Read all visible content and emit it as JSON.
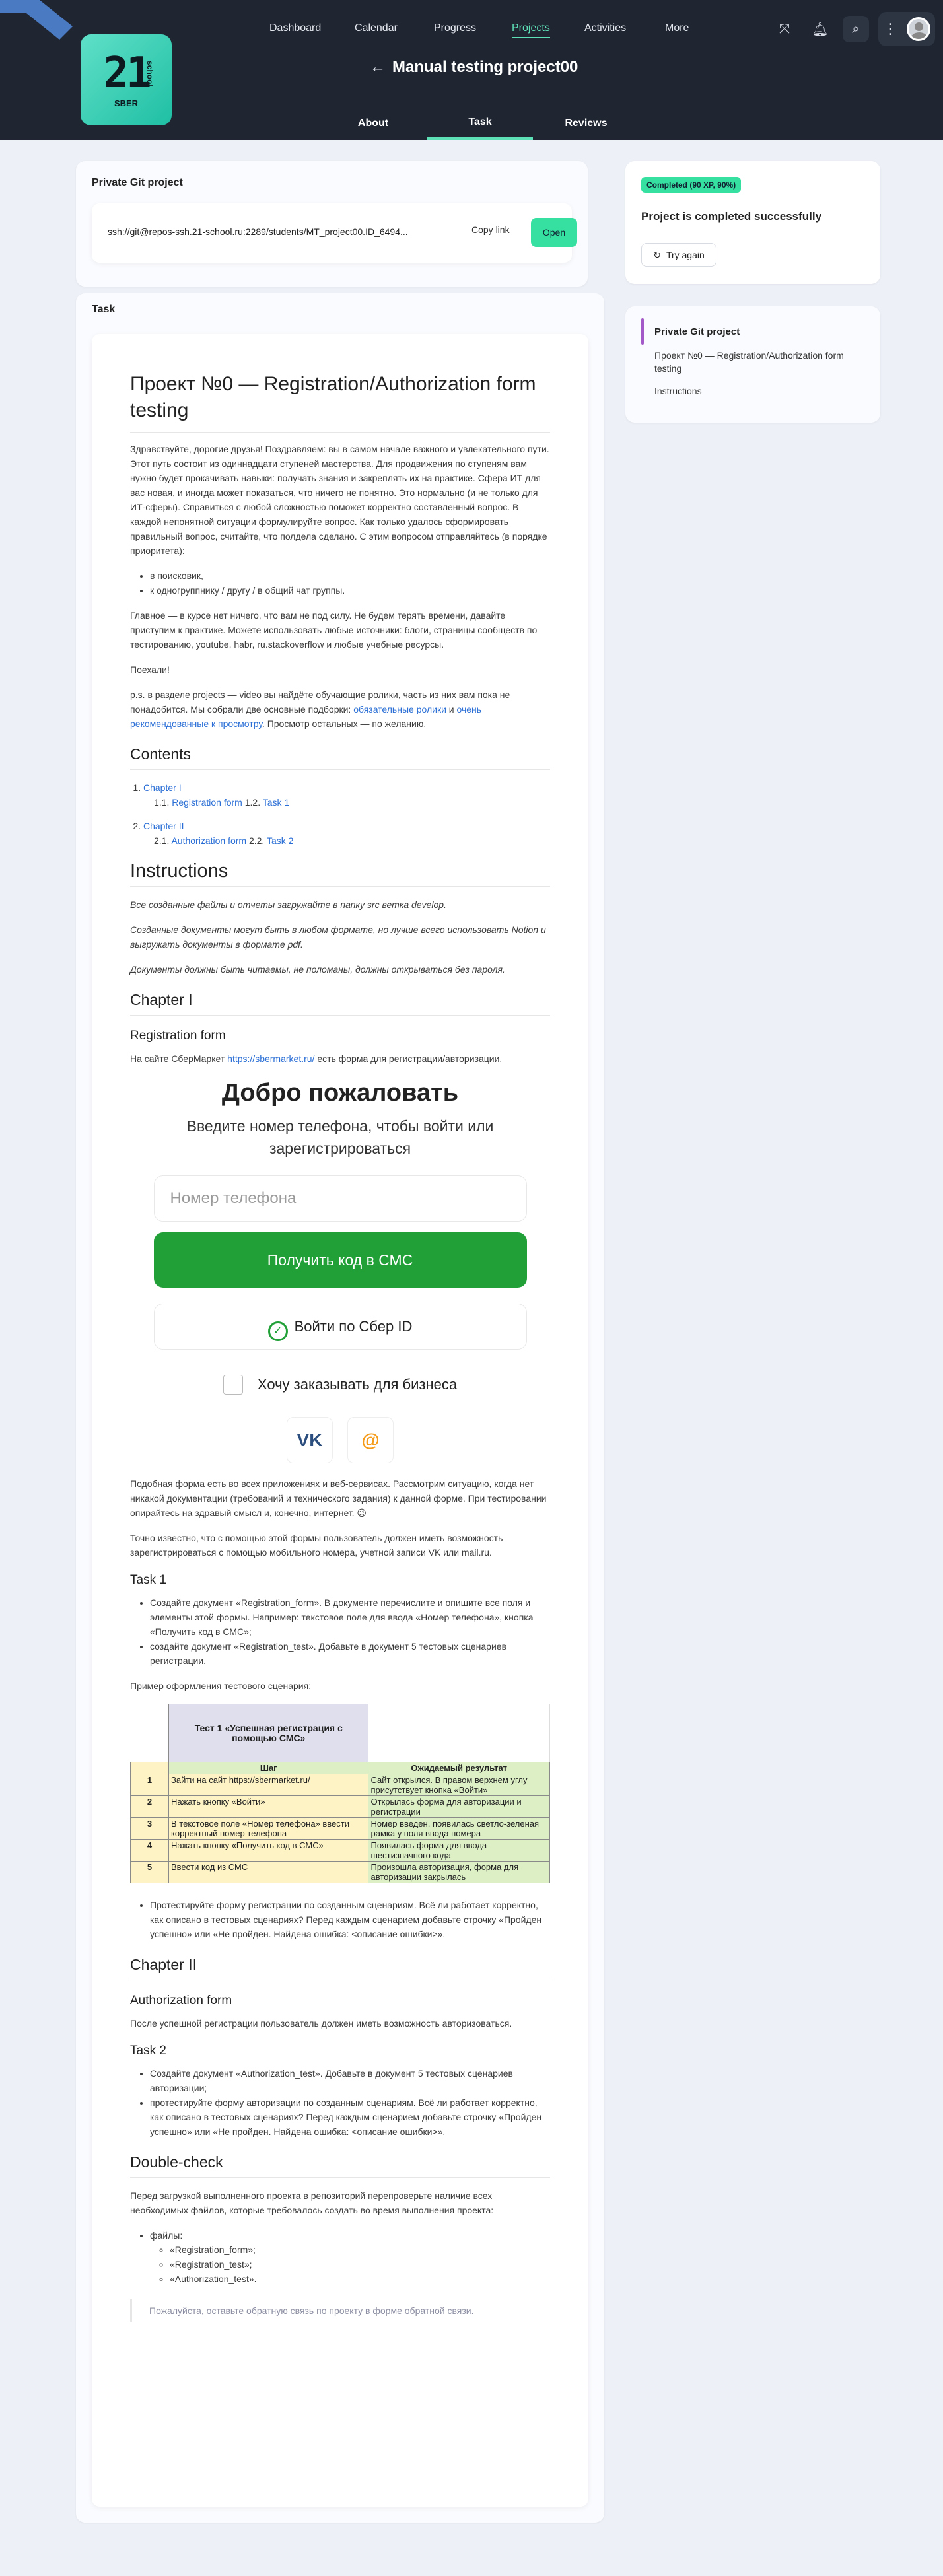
{
  "header": {
    "nav": [
      "Dashboard",
      "Calendar",
      "Progress",
      "Projects",
      "Activities",
      "More"
    ],
    "logo": {
      "big": "21",
      "side": "school",
      "sub": "SBER"
    },
    "title": "Manual testing project00",
    "tabs": [
      "About",
      "Task",
      "Reviews"
    ]
  },
  "git": {
    "label": "Private Git project",
    "path": "ssh://git@repos-ssh.21-school.ru:2289/students/MT_project00.ID_6494...",
    "copy": "Copy link",
    "open": "Open"
  },
  "status": {
    "badge": "Completed (90 XP, 90%)",
    "title": "Project is completed successfully",
    "again": "Try again"
  },
  "toc": {
    "items": [
      "Private Git project",
      "Проект №0 — Registration/Authorization form testing",
      "Instructions"
    ]
  },
  "task": {
    "label": "Task",
    "h1": "Проект №0 — Registration/Authorization form testing",
    "p1": "Здравствуйте, дорогие друзья! Поздравляем: вы в самом начале важного и увлекательного пути. Этот путь состоит из одиннадцати ступеней мастерства. Для продвижения по ступеням вам нужно будет прокачивать навыки: получать знания и закреплять их на практике. Сфера ИТ для вас новая, и иногда может показаться, что ничего не понятно. Это нормально (и не только для ИТ-сферы). Справиться с любой сложностью поможет корректно составленный вопрос. В каждой непонятной ситуации формулируйте вопрос. Как только удалось сформировать правильный вопрос, считайте, что полдела сделано. С этим вопросом отправляйтесь (в порядке приоритета):",
    "l1": [
      "в поисковик,",
      "к одногруппнику / другу / в общий чат группы."
    ],
    "p2": "Главное — в курсе нет ничего, что вам не под силу. Не будем терять времени, давайте приступим к практике. Можете использовать любые источники: блоги, страницы сообществ по тестированию, youtube, habr, ru.stackoverflow и любые учебные ресурсы.",
    "p3": "Поехали!",
    "p4a": "p.s. в разделе projects — video вы найдёте обучающие ролики, часть из них вам пока не понадобится. Мы собрали две основные подборки:",
    "p4l1": "обязательные ролики",
    "p4m": " и ",
    "p4l2": "очень рекомендованные к просмотру",
    "p4b": ". Просмотр остальных — по желанию.",
    "contents": "Contents",
    "c1": "Chapter I",
    "c11a": "1.1. ",
    "c11": "Registration form",
    "c12a": " 1.2. ",
    "c12": "Task 1",
    "c2": "Chapter II",
    "c21a": "2.1. ",
    "c21": "Authorization form",
    "c22a": " 2.2. ",
    "c22": "Task 2",
    "instr": "Instructions",
    "i1": "Все созданные файлы и отчеты загружайте в папку src ветка develop.",
    "i2": "Созданные документы могут быть в любом формате, но лучше всего использовать Notion и выгружать документы в формате pdf.",
    "i3": "Документы должны быть читаемы, не поломаны, должны открываться без пароля.",
    "ch1": "Chapter I",
    "rf": "Registration form",
    "rf_pa": "На сайте СберМаркет ",
    "rf_link": "https://sbermarket.ru/",
    "rf_pb": " есть форма для регистрации/авторизации.",
    "form": {
      "welcome": "Добро пожаловать",
      "sub": "Введите номер телефона, чтобы войти или зарегистрироваться",
      "phone": "Номер телефона",
      "sms": "Получить код в СМС",
      "sberid": "Войти по Сбер ID",
      "biz": "Хочу заказывать для бизнеса",
      "vk": "VK",
      "mail": "@"
    },
    "p5": "Подобная форма есть во всех приложениях и веб-сервисах. Рассмотрим ситуацию, когда нет никакой документации (требований и технического задания) к данной форме. При тестировании опирайтесь на здравый смысл и, конечно, интернет. 😉",
    "p6": "Точно известно, что с помощью этой формы пользователь должен иметь возможность зарегистрироваться с помощью мобильного номера, учетной записи VK или mail.ru.",
    "t1": "Task 1",
    "t1l": [
      "Создайте документ «Registration_form». В документе перечислите и опишите все поля и элементы этой формы. Например: текстовое поле для ввода «Номер телефона», кнопка «Получить код в СМС»;",
      "создайте документ «Registration_test». Добавьте в документ 5 тестовых сценариев регистрации."
    ],
    "p7": "Пример оформления тестового сценария:",
    "table": {
      "title": "Тест 1 «Успешная регистрация с помощью СМС»",
      "h_step": "Шаг",
      "h_res": "Ожидаемый результат",
      "rows": [
        {
          "n": "1",
          "step": "Зайти на сайт https://sbermarket.ru/",
          "res": "Сайт открылся. В правом верхнем углу присутствует кнопка «Войти»"
        },
        {
          "n": "2",
          "step": "Нажать кнопку «Войти»",
          "res": "Открылась форма для авторизации и регистрации"
        },
        {
          "n": "3",
          "step": "В текстовое поле «Номер телефона» ввести корректный номер телефона",
          "res": "Номер введен, появилась светло-зеленая рамка у поля ввода номера"
        },
        {
          "n": "4",
          "step": "Нажать кнопку «Получить код в СМС»",
          "res": "Появилась форма для ввода шестизначного кода"
        },
        {
          "n": "5",
          "step": "Ввести код из СМС",
          "res": "Произошла авторизация, форма для авторизации закрылась"
        }
      ]
    },
    "t1l2": "Протестируйте форму регистрации по созданным сценариям. Всё ли работает корректно, как описано в тестовых сценариях? Перед каждым сценарием добавьте строчку «Пройден успешно» или «Не пройден. Найдена ошибка: <описание ошибки>».",
    "ch2": "Chapter II",
    "af": "Authorization form",
    "p8": "После успешной регистрации пользователь должен иметь возможность авторизоваться.",
    "t2": "Task 2",
    "t2l": [
      "Создайте документ «Authorization_test». Добавьте в документ 5 тестовых сценариев авторизации;",
      "протестируйте форму авторизации по созданным сценариям. Всё ли работает корректно, как описано в тестовых сценариях? Перед каждым сценарием добавьте строчку «Пройден успешно» или «Не пройден. Найдена ошибка: <описание ошибки>»."
    ],
    "dc": "Double-check",
    "p9": "Перед загрузкой выполненного проекта в репозиторий перепроверьте наличие всех необходимых файлов, которые требовалось создать во время выполнения проекта:",
    "files": "файлы:",
    "fl": [
      "«Registration_form»;",
      "«Registration_test»;",
      "«Authorization_test»."
    ],
    "fb": "Пожалуйста, оставьте обратную связь по проекту в форме обратной связи."
  }
}
